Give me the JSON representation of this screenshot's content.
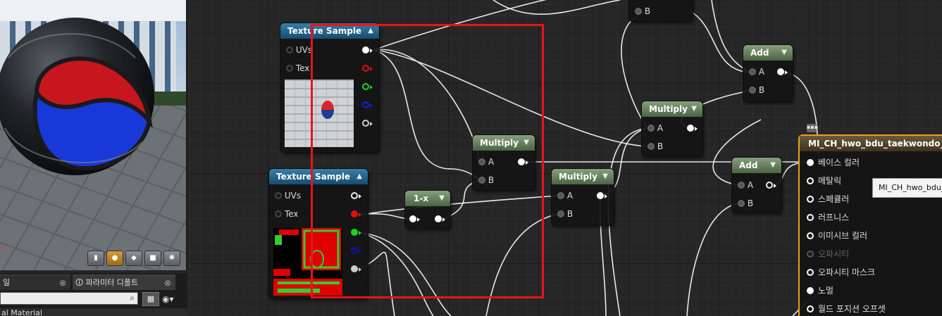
{
  "preview": {
    "axis_label": "x",
    "view_buttons": [
      "cylinder-icon",
      "sphere-icon",
      "plane-icon",
      "cube-icon",
      "custom-mesh-icon"
    ]
  },
  "bottom_panel": {
    "tabs": [
      {
        "label": "일",
        "close": "⊗"
      },
      {
        "label": "파라미터 디폴트",
        "close": "⊗"
      }
    ],
    "search_placeholder": "",
    "bottom_label": "al Material"
  },
  "nodes": {
    "tex1": {
      "title": "Texture Sample",
      "pins_in": [
        "UVs",
        "Tex"
      ]
    },
    "tex2": {
      "title": "Texture Sample",
      "pins_in": [
        "UVs",
        "Tex"
      ]
    },
    "one_minus": {
      "title": "1-x"
    },
    "mul1": {
      "title": "Multiply",
      "a": "A",
      "b": "B"
    },
    "mul2": {
      "title": "Multiply",
      "a": "A",
      "b": "B"
    },
    "mul3": {
      "title": "Multiply",
      "a": "A",
      "b": "B"
    },
    "add1": {
      "title": "Add",
      "a": "A",
      "b": "B"
    },
    "add2": {
      "title": "Add",
      "a": "A",
      "b": "B"
    },
    "partial": {
      "b": "B"
    }
  },
  "result": {
    "title": "MI_CH_hwo_bdu_taekwondo_glov",
    "pins": [
      "베이스 컬러",
      "메탈릭",
      "스페큘러",
      "러프니스",
      "이미시브 컬러",
      "오파시티",
      "오파시티 마스크",
      "노멀",
      "월드 포지션 오프셋"
    ]
  },
  "tooltip": {
    "text": "MI_CH_hwo_bdu_"
  },
  "colors": {
    "accent": "#e7a020",
    "highlight": "#e8141c",
    "texture_header": "#2a6a92",
    "math_header": "#6a845f"
  }
}
